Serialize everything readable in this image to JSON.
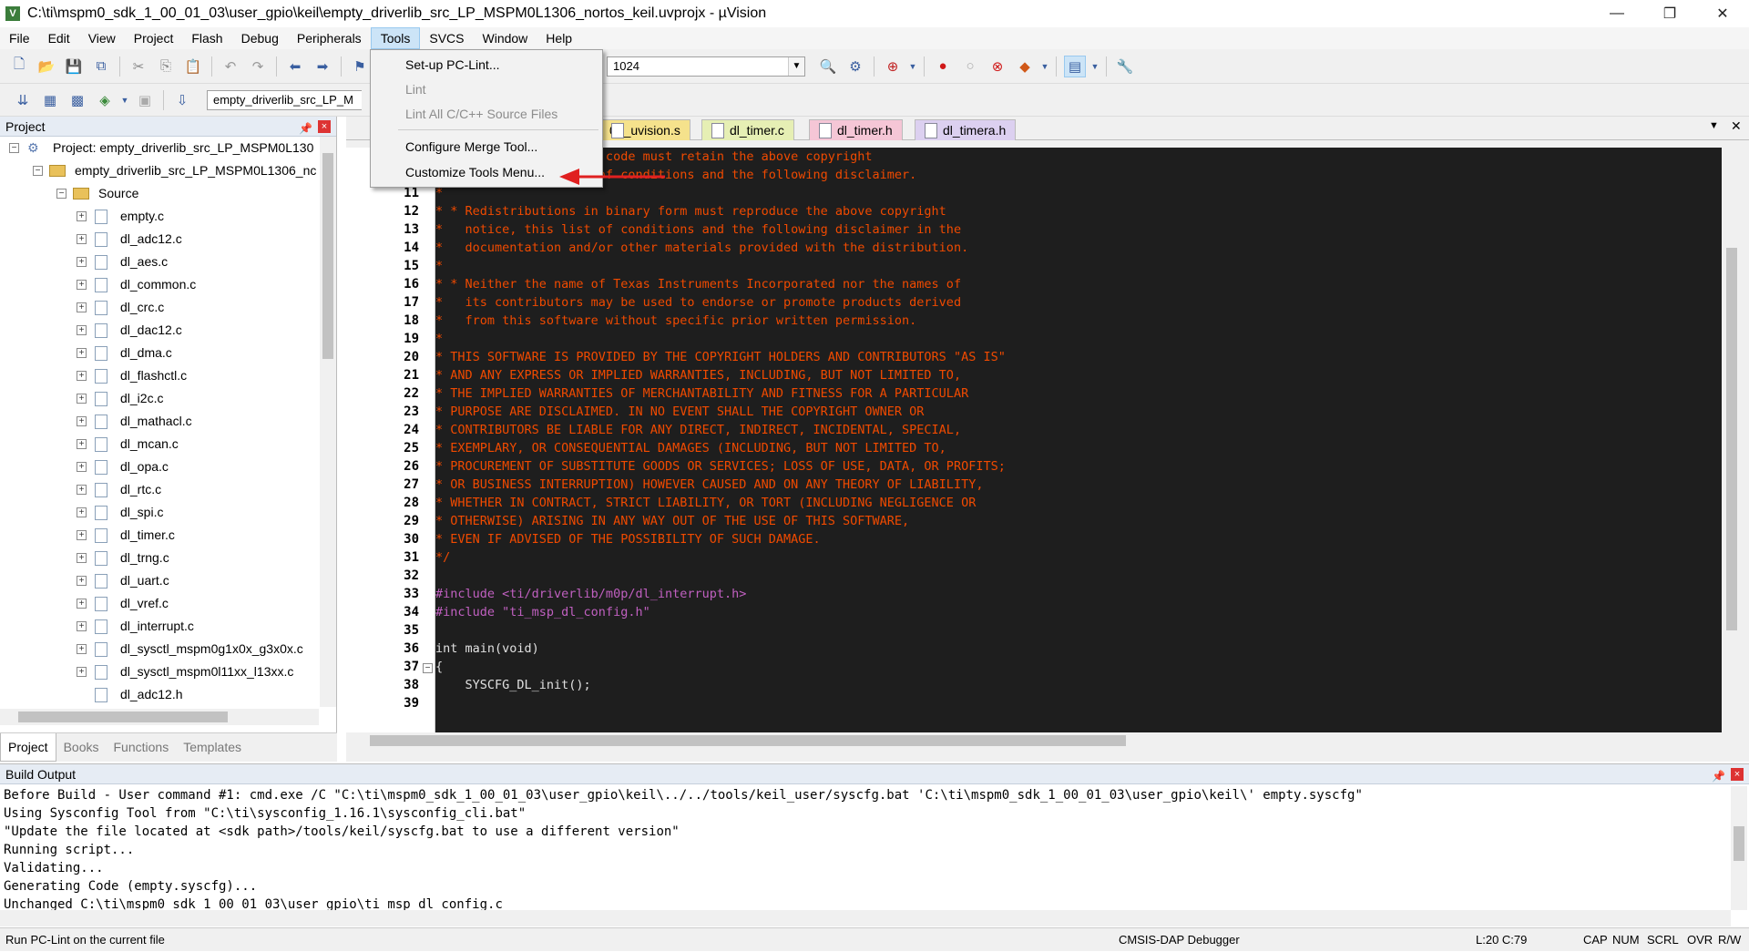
{
  "window": {
    "title": "C:\\ti\\mspm0_sdk_1_00_01_03\\user_gpio\\keil\\empty_driverlib_src_LP_MSPM0L1306_nortos_keil.uvprojx - µVision",
    "min": "—",
    "restore": "❐",
    "close": "✕"
  },
  "menubar": [
    "File",
    "Edit",
    "View",
    "Project",
    "Flash",
    "Debug",
    "Peripherals",
    "Tools",
    "SVCS",
    "Window",
    "Help"
  ],
  "toolbar1": {
    "combo_value": "1024"
  },
  "toolbar2": {
    "target_combo": "empty_driverlib_src_LP_M"
  },
  "tools_menu": {
    "items": [
      {
        "label": "Set-up PC-Lint...",
        "enabled": true
      },
      {
        "label": "Lint",
        "enabled": false
      },
      {
        "label": "Lint All C/C++ Source Files",
        "enabled": false
      },
      {
        "label": "Configure Merge Tool...",
        "enabled": true
      },
      {
        "label": "Customize Tools Menu...",
        "enabled": true
      }
    ]
  },
  "project_pane": {
    "title": "Project",
    "root": "Project: empty_driverlib_src_LP_MSPM0L130",
    "target": "empty_driverlib_src_LP_MSPM0L1306_nc",
    "group": "Source",
    "files": [
      "empty.c",
      "dl_adc12.c",
      "dl_aes.c",
      "dl_common.c",
      "dl_crc.c",
      "dl_dac12.c",
      "dl_dma.c",
      "dl_flashctl.c",
      "dl_i2c.c",
      "dl_mathacl.c",
      "dl_mcan.c",
      "dl_opa.c",
      "dl_rtc.c",
      "dl_spi.c",
      "dl_timer.c",
      "dl_trng.c",
      "dl_uart.c",
      "dl_vref.c",
      "dl_interrupt.c",
      "dl_sysctl_mspm0g1x0x_g3x0x.c",
      "dl_sysctl_mspm0l11xx_l13xx.c",
      "dl_adc12.h"
    ],
    "tabs": [
      "Project",
      "Books",
      "Functions",
      "Templates"
    ]
  },
  "editor": {
    "tabs": [
      "06_uvision.s",
      "dl_timer.c",
      "dl_timer.h",
      "dl_timera.h"
    ],
    "tab_colors": [
      "#f5e28c",
      "#e6efb4",
      "#f5c6d6",
      "#dcd0f0"
    ],
    "lines": [
      {
        "n": "",
        "t": "                source code must retain the above copyright",
        "k": "c"
      },
      {
        "n": "",
        "t": "    notice, this list of conditions and the following disclaimer.",
        "k": "c"
      },
      {
        "n": "11",
        "t": "*",
        "k": "c"
      },
      {
        "n": "12",
        "t": "* * Redistributions in binary form must reproduce the above copyright",
        "k": "c"
      },
      {
        "n": "13",
        "t": "*   notice, this list of conditions and the following disclaimer in the",
        "k": "c"
      },
      {
        "n": "14",
        "t": "*   documentation and/or other materials provided with the distribution.",
        "k": "c"
      },
      {
        "n": "15",
        "t": "*",
        "k": "c"
      },
      {
        "n": "16",
        "t": "* * Neither the name of Texas Instruments Incorporated nor the names of",
        "k": "c"
      },
      {
        "n": "17",
        "t": "*   its contributors may be used to endorse or promote products derived",
        "k": "c"
      },
      {
        "n": "18",
        "t": "*   from this software without specific prior written permission.",
        "k": "c"
      },
      {
        "n": "19",
        "t": "*",
        "k": "c"
      },
      {
        "n": "20",
        "t": "* THIS SOFTWARE IS PROVIDED BY THE COPYRIGHT HOLDERS AND CONTRIBUTORS \"AS IS\"",
        "k": "c"
      },
      {
        "n": "21",
        "t": "* AND ANY EXPRESS OR IMPLIED WARRANTIES, INCLUDING, BUT NOT LIMITED TO,",
        "k": "c"
      },
      {
        "n": "22",
        "t": "* THE IMPLIED WARRANTIES OF MERCHANTABILITY AND FITNESS FOR A PARTICULAR",
        "k": "c"
      },
      {
        "n": "23",
        "t": "* PURPOSE ARE DISCLAIMED. IN NO EVENT SHALL THE COPYRIGHT OWNER OR",
        "k": "c"
      },
      {
        "n": "24",
        "t": "* CONTRIBUTORS BE LIABLE FOR ANY DIRECT, INDIRECT, INCIDENTAL, SPECIAL,",
        "k": "c"
      },
      {
        "n": "25",
        "t": "* EXEMPLARY, OR CONSEQUENTIAL DAMAGES (INCLUDING, BUT NOT LIMITED TO,",
        "k": "c"
      },
      {
        "n": "26",
        "t": "* PROCUREMENT OF SUBSTITUTE GOODS OR SERVICES; LOSS OF USE, DATA, OR PROFITS;",
        "k": "c"
      },
      {
        "n": "27",
        "t": "* OR BUSINESS INTERRUPTION) HOWEVER CAUSED AND ON ANY THEORY OF LIABILITY,",
        "k": "c"
      },
      {
        "n": "28",
        "t": "* WHETHER IN CONTRACT, STRICT LIABILITY, OR TORT (INCLUDING NEGLIGENCE OR",
        "k": "c"
      },
      {
        "n": "29",
        "t": "* OTHERWISE) ARISING IN ANY WAY OUT OF THE USE OF THIS SOFTWARE,",
        "k": "c"
      },
      {
        "n": "30",
        "t": "* EVEN IF ADVISED OF THE POSSIBILITY OF SUCH DAMAGE.",
        "k": "c"
      },
      {
        "n": "31",
        "t": "*/",
        "k": "c"
      },
      {
        "n": "32",
        "t": "",
        "k": "n"
      },
      {
        "n": "33",
        "t": "#include <ti/driverlib/m0p/dl_interrupt.h>",
        "k": "i"
      },
      {
        "n": "34",
        "t": "#include \"ti_msp_dl_config.h\"",
        "k": "i"
      },
      {
        "n": "35",
        "t": "",
        "k": "n"
      },
      {
        "n": "36",
        "t": "int main(void)",
        "k": "n"
      },
      {
        "n": "37",
        "t": "{",
        "k": "n"
      },
      {
        "n": "38",
        "t": "    SYSCFG_DL_init();",
        "k": "n"
      },
      {
        "n": "39",
        "t": "",
        "k": "n"
      }
    ]
  },
  "build_output": {
    "title": "Build Output",
    "lines": [
      "Before Build - User command #1: cmd.exe /C \"C:\\ti\\mspm0_sdk_1_00_01_03\\user_gpio\\keil\\../../tools/keil_user/syscfg.bat 'C:\\ti\\mspm0_sdk_1_00_01_03\\user_gpio\\keil\\' empty.syscfg\"",
      "Using Sysconfig Tool from \"C:\\ti\\sysconfig_1.16.1\\sysconfig_cli.bat\"",
      "\"Update the file located at <sdk path>/tools/keil/syscfg.bat to use a different version\"",
      "Running script...",
      "Validating...",
      "Generating Code (empty.syscfg)...",
      "Unchanged C:\\ti\\mspm0_sdk_1_00_01_03\\user_gpio\\ti_msp_dl_config.c"
    ]
  },
  "status": {
    "message": "Run PC-Lint on the current file",
    "debugger": "CMSIS-DAP Debugger",
    "position": "L:20 C:79",
    "indicators": [
      "CAP",
      "NUM",
      "SCRL",
      "OVR",
      "R/W"
    ]
  },
  "colors": {
    "arrow": "#e02020",
    "menu_active": "#cce4f7",
    "code_bg": "#1e1e1e",
    "comment": "#f04a00",
    "include": "#c060c0"
  },
  "icons": [
    "new-file-icon",
    "open-icon",
    "save-icon",
    "cut-icon",
    "copy-icon",
    "paste-icon",
    "undo-icon",
    "redo-icon",
    "nav-back-icon",
    "nav-forward-icon",
    "build-icon",
    "debug-icon",
    "breakpoint-icon",
    "wrench-icon"
  ]
}
